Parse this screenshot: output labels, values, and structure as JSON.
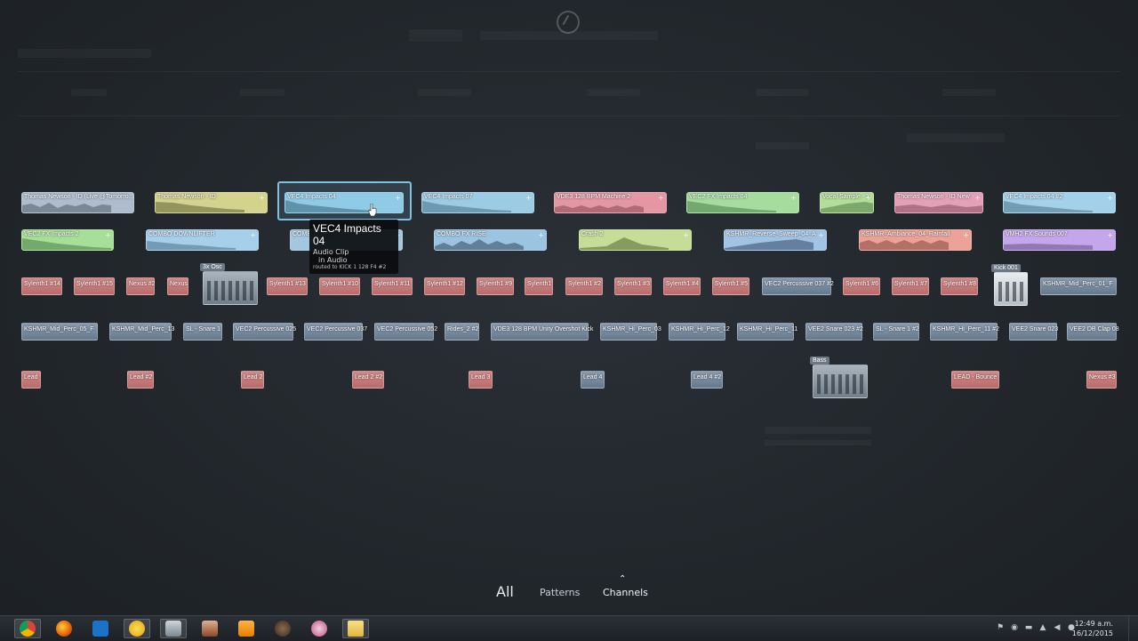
{
  "clips": [
    {
      "id": "c1",
      "label": "Thomas Newson - ID (Live @Tomorro...",
      "color": "#b8c4d4",
      "row": 0
    },
    {
      "id": "c2",
      "label": "Thomas Newson - ID",
      "color": "#d9d98f",
      "row": 0
    },
    {
      "id": "c3",
      "label": "VEC4 Impacts 04",
      "color": "#8fcde8",
      "row": 0,
      "selected": true
    },
    {
      "id": "c4",
      "label": "VEC4 Impacts 07",
      "color": "#9ccde6",
      "row": 0
    },
    {
      "id": "c5",
      "label": "VDE3 128 BPM Machine 2",
      "color": "#e89aa6",
      "row": 0
    },
    {
      "id": "c6",
      "label": "VEC2 FX Impacts 04",
      "color": "#a8e0a0",
      "row": 0
    },
    {
      "id": "c7",
      "label": "Vocal Sample - 1",
      "color": "#b6e09a",
      "row": 0
    },
    {
      "id": "c8",
      "label": "Thomas Newson - ID New",
      "color": "#e6a2b8",
      "row": 0
    },
    {
      "id": "c9",
      "label": "VEC4 Impacts 04 #2",
      "color": "#a6d4ec",
      "row": 0
    },
    {
      "id": "c10",
      "label": "VEC2 FX Impacts 2",
      "color": "#a8e29a",
      "row": 1
    },
    {
      "id": "c11",
      "label": "COMBO DOWNLIFTER",
      "color": "#a8d2ec",
      "row": 1
    },
    {
      "id": "c12",
      "label": "COMBO DOWN",
      "color": "#a6c8e0",
      "row": 1
    },
    {
      "id": "c13",
      "label": "COMBO FX RISE",
      "color": "#9cc6e2",
      "row": 1
    },
    {
      "id": "c14",
      "label": "Crash 2",
      "color": "#c8e09a",
      "row": 1
    },
    {
      "id": "c15",
      "label": "KSHMR_Reverse_Sweep_04_A",
      "color": "#a4c6e6",
      "row": 1
    },
    {
      "id": "c16",
      "label": "KSHMR_Ambiance_04_Rainfall",
      "color": "#eea49a",
      "row": 1
    },
    {
      "id": "c17",
      "label": "VMH2 FX Sounds 007",
      "color": "#c8a8ec",
      "row": 1
    }
  ],
  "row3_patterns": [
    "Sylenth1 #14",
    "Sylenth1 #15",
    "Nexus #2",
    "Nexus",
    "Sylenth1 #13",
    "Sylenth1 #10",
    "Sylenth1 #11",
    "Sylenth1 #12",
    "Sylenth1 #9",
    "Sylenth1",
    "Sylenth1 #2",
    "Sylenth1 #3",
    "Sylenth1 #4",
    "Sylenth1 #5",
    "VEC2 Percussive 037 #2",
    "Sylenth1 #6",
    "Sylenth1 #7",
    "Sylenth1 #8",
    "KSHMR_Mid_Perc_01_F"
  ],
  "row4_patterns": [
    "KSHMR_Mid_Perc_05_F",
    "KSHMR_Mid_Perc_13",
    "SL - Snare 1",
    "VEC2 Percussive 025",
    "VEC2 Percussive 037",
    "VEC2 Percussive 052",
    "Rides_2 #2",
    "VDE3 128 BPM Unity Overshot Kick",
    "KSHMR_Hi_Perc_03",
    "KSHMR_Hi_Perc_12",
    "KSHMR_Hi_Perc_11",
    "VEE2 Snare 023 #2",
    "SL - Snare 1 #2",
    "KSHMR_Hi_Perc_11 #2",
    "VEE2 Snare 023",
    "VEE2 DB Clap 08"
  ],
  "row5_patterns": [
    "Lead",
    "Lead #2",
    "Lead 2",
    "Lead 2 #2",
    "Lead 3",
    "Lead 4",
    "Lead 4 #2",
    "LEAD - Bounce",
    "Nexus #3"
  ],
  "plugins": {
    "osc": "3x Osc",
    "kick": "Kick 001",
    "bass": "Bass"
  },
  "tooltip": {
    "title": "VEC4 Impacts 04",
    "line1": "Audio Clip",
    "line2": "in Audio",
    "line3": "routed to KICK 1 128 F4 #2"
  },
  "tabs": {
    "all": "All",
    "patterns": "Patterns",
    "channels": "Channels"
  },
  "clock": {
    "time": "12:49 a.m.",
    "date": "16/12/2015"
  },
  "taskbar_icons": [
    "chrome-icon",
    "firefox-icon",
    "maxthon-icon",
    "fl-studio-icon",
    "app-icon",
    "character-icon",
    "media-player-icon",
    "gangster-icon",
    "paint-icon",
    "folder-icon"
  ]
}
